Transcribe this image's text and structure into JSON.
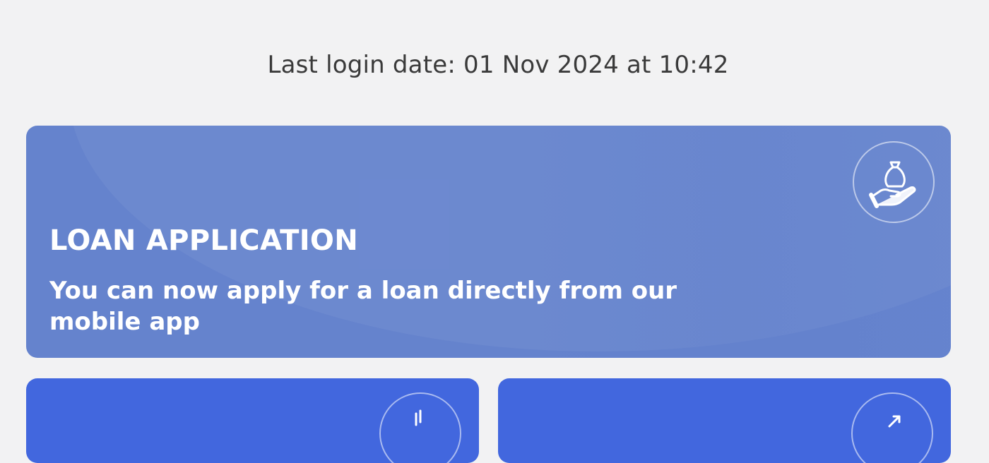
{
  "last_login": {
    "text": "Last login date: 01 Nov 2024 at 10:42"
  },
  "loan_card": {
    "title": "LOAN APPLICATION",
    "description": "You can now apply for a loan directly from our mobile app",
    "icon": "money-bag-hand-icon",
    "color": "#6583cd"
  },
  "bottom_cards": [
    {
      "icon": "bottom-left-card-icon",
      "color": "#4267de"
    },
    {
      "icon": "transfer-icon",
      "color": "#4267de"
    }
  ],
  "colors": {
    "background": "#f2f2f3",
    "text_dark": "#3a3a3a",
    "text_light": "#ffffff"
  }
}
